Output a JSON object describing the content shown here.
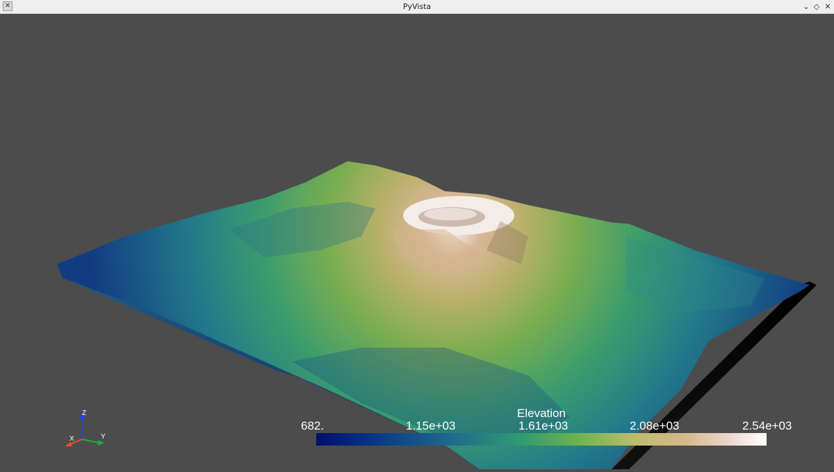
{
  "window": {
    "title": "PyVista",
    "icon": "x-app-icon",
    "controls": [
      "chevron-down-icon",
      "restore-icon",
      "close-icon"
    ]
  },
  "colors": {
    "background": "#4c4c4c",
    "low": "#00106a",
    "mid": "#6db24f",
    "high": "#ffffff"
  },
  "scalar_bar": {
    "title": "Elevation",
    "ticks": [
      "682.",
      "1.15e+03",
      "1.61e+03",
      "2.08e+03",
      "2.54e+03"
    ]
  },
  "axes": {
    "x": "X",
    "y": "Y",
    "z": "Z"
  }
}
